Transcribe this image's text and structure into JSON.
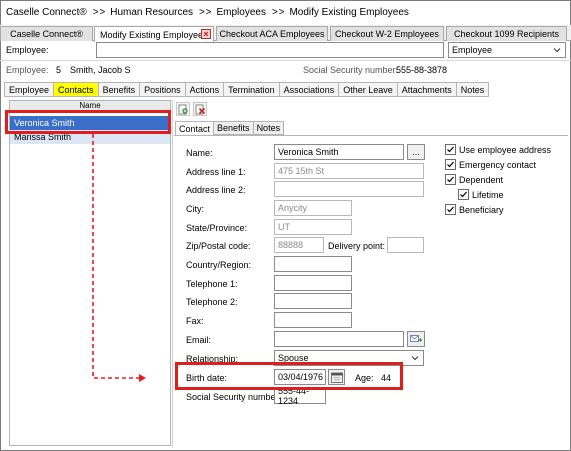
{
  "breadcrumb": {
    "items": [
      "Caselle Connect®",
      "Human Resources",
      "Employees",
      "Modify Existing Employees"
    ],
    "separator": "> >"
  },
  "doc_tabs": [
    {
      "label": "Caselle Connect®",
      "active": false
    },
    {
      "label": "Modify Existing Employees",
      "active": true
    },
    {
      "label": "Checkout ACA Employees",
      "active": false
    },
    {
      "label": "Checkout W-2 Employees",
      "active": false
    },
    {
      "label": "Checkout 1099 Recipients",
      "active": false
    }
  ],
  "employee_bar": {
    "label": "Employee:",
    "input_value": "",
    "type_select": "Employee"
  },
  "info": {
    "employee_label": "Employee:",
    "employee_number": "5",
    "employee_name": "Smith, Jacob S",
    "ssn_label": "Social Security number:",
    "ssn_value": "555-88-3878"
  },
  "section_tabs": [
    "Employee",
    "Contacts",
    "Benefits",
    "Positions",
    "Actions",
    "Termination",
    "Associations",
    "Other Leave",
    "Attachments",
    "Notes"
  ],
  "active_section": "Contacts",
  "contacts_list": {
    "header": "Name",
    "rows": [
      "Veronica Smith",
      "Marissa Smith"
    ]
  },
  "inner_tabs": [
    "Contact",
    "Benefits",
    "Notes"
  ],
  "form": {
    "name_label": "Name:",
    "name_value": "Veronica Smith",
    "ellipsis": "...",
    "address1_label": "Address line 1:",
    "address1_value": "475 15th St",
    "address2_label": "Address line 2:",
    "address2_value": "",
    "city_label": "City:",
    "city_value": "Anycity",
    "state_label": "State/Province:",
    "state_value": "UT",
    "zip_label": "Zip/Postal code:",
    "zip_value": "88888",
    "delivery_label": "Delivery point:",
    "delivery_value": "",
    "country_label": "Country/Region:",
    "country_value": "",
    "tel1_label": "Telephone 1:",
    "tel1_value": "",
    "tel2_label": "Telephone 2:",
    "tel2_value": "",
    "fax_label": "Fax:",
    "fax_value": "",
    "email_label": "Email:",
    "email_value": "",
    "relationship_label": "Relationship:",
    "relationship_value": "Spouse",
    "birth_label": "Birth date:",
    "birth_value": "03/04/1976",
    "age_label": "Age:",
    "age_value": "44",
    "ssn_label": "Social Security number:",
    "ssn_value": "555-44-1234"
  },
  "checkboxes": [
    {
      "label": "Use employee address",
      "checked": true
    },
    {
      "label": "Emergency contact",
      "checked": true
    },
    {
      "label": "Dependent",
      "checked": true
    },
    {
      "label": "Lifetime",
      "checked": true
    },
    {
      "label": "Beneficiary",
      "checked": true
    }
  ],
  "colors": {
    "highlight_red": "#e01e1e",
    "active_tab_yellow": "#ffff00",
    "selected_row": "#3a6fc9",
    "alt_row": "#dde6f5"
  }
}
